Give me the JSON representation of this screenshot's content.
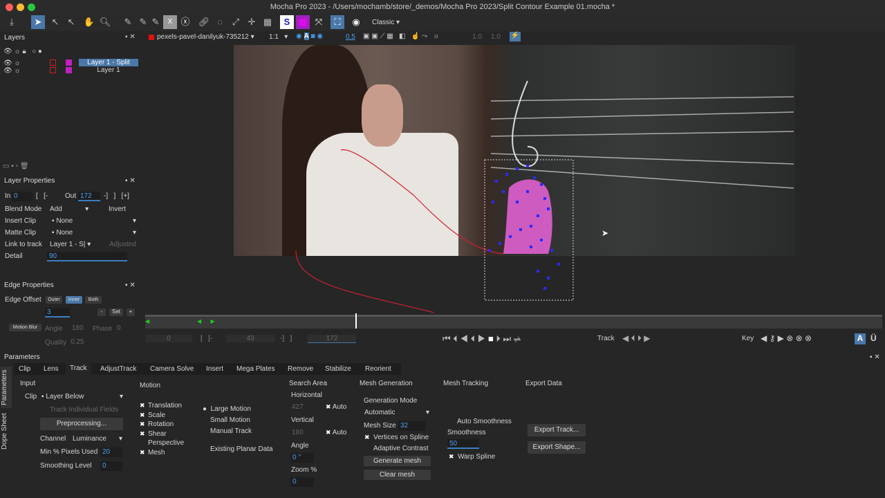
{
  "window": {
    "title": "Mocha Pro 2023 - /Users/mochamb/store/_demos/Mocha Pro 2023/Split Contour Example 01.mocha *"
  },
  "toolbar": {
    "workspace": "Classic",
    "clip": "pexels-pavel-danilyuk-735212",
    "zoom": "1:1",
    "opacity": "0.5",
    "gain1": "1.0",
    "gain2": "1.0"
  },
  "layers": {
    "title": "Layers",
    "items": [
      {
        "name": "Layer 1 - Split",
        "selected": true
      },
      {
        "name": "Layer 1",
        "selected": false
      }
    ]
  },
  "layer_props": {
    "title": "Layer Properties",
    "in_label": "In",
    "in": "0",
    "out_label": "Out",
    "out": "172",
    "blend_label": "Blend Mode",
    "blend": "Add",
    "invert": "Invert",
    "insert_label": "Insert Clip",
    "insert": "None",
    "matte_label": "Matte Clip",
    "matte": "None",
    "link_label": "Link to track",
    "link": "Layer 1 - S|",
    "adjusted": "Adjusted",
    "detail_label": "Detail",
    "detail": "90"
  },
  "edge_props": {
    "title": "Edge Properties",
    "offset_label": "Edge Offset",
    "outer": "Outer",
    "inner": "Inner",
    "both": "Both",
    "offset": "3",
    "minus": "-",
    "set": "Set",
    "plus": "+",
    "motion_blur": "Motion Blur",
    "angle_label": "Angle",
    "angle": "180",
    "phase_label": "Phase",
    "phase": "0",
    "quality_label": "Quality",
    "quality": "0.25"
  },
  "transport": {
    "start": "0",
    "current": "43",
    "end": "172",
    "track_label": "Track",
    "key_label": "Key"
  },
  "params": {
    "title": "Parameters",
    "side_tabs": [
      "Parameters",
      "Dope Sheet"
    ],
    "tabs": [
      "Clip",
      "Lens",
      "Track",
      "AdjustTrack",
      "Camera Solve",
      "Insert",
      "Mega Plates",
      "Remove",
      "Stabilize",
      "Reorient"
    ],
    "active_tab": "Track",
    "input": {
      "title": "Input",
      "clip_label": "Clip",
      "clip": "Layer Below",
      "track_fields": "Track Individual Fields",
      "preprocessing": "Preprocessing...",
      "channel_label": "Channel",
      "channel": "Luminance",
      "min_label": "Min % Pixels Used",
      "min": "20",
      "smooth_label": "Smoothing Level",
      "smooth": "0"
    },
    "motion": {
      "title": "Motion",
      "checks": [
        {
          "label": "Translation",
          "on": true
        },
        {
          "label": "Scale",
          "on": true
        },
        {
          "label": "Rotation",
          "on": true
        },
        {
          "label": "Shear",
          "on": true
        },
        {
          "label": "Perspective",
          "on": false
        },
        {
          "label": "Mesh",
          "on": true
        }
      ],
      "radios": [
        "Large Motion",
        "Small Motion",
        "Manual Track"
      ],
      "radio_selected": "Large Motion",
      "existing": "Existing Planar Data"
    },
    "search": {
      "title": "Search Area",
      "h_label": "Horizontal",
      "h": "427",
      "auto": "Auto",
      "v_label": "Vertical",
      "v": "180",
      "angle_label": "Angle",
      "angle": "0 °",
      "zoom_label": "Zoom %",
      "zoom": "0"
    },
    "mesh_gen": {
      "title": "Mesh Generation",
      "mode_label": "Generation Mode",
      "mode": "Automatic",
      "size_label": "Mesh Size",
      "size": "32",
      "vertices": "Vertices on Spline",
      "adaptive": "Adaptive Contrast",
      "generate": "Generate mesh",
      "clear": "Clear mesh"
    },
    "mesh_track": {
      "title": "Mesh Tracking",
      "auto_smooth": "Auto Smoothness",
      "smooth_label": "Smoothness",
      "smooth": "50",
      "warp": "Warp Spline"
    },
    "export": {
      "title": "Export Data",
      "track": "Export Track...",
      "shape": "Export Shape..."
    }
  },
  "colors": {
    "accent": "#4a78a8",
    "mesh": "#2a2aff",
    "matte": "#e060d0"
  }
}
